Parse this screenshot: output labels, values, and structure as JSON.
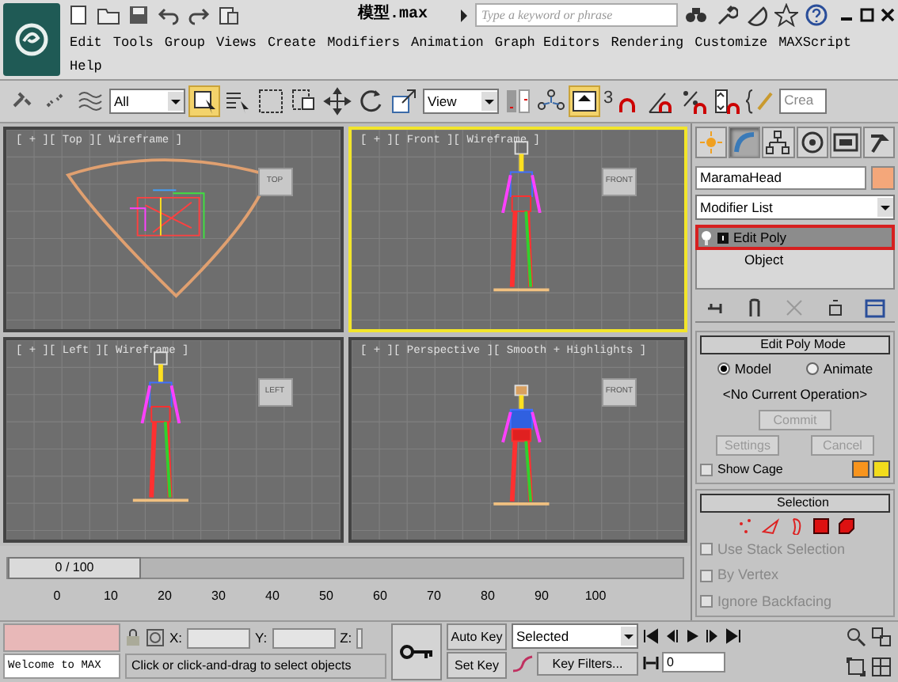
{
  "title_bar": {
    "title": "模型.max",
    "search": {
      "placeholder": "Type a keyword or phrase"
    }
  },
  "menu": [
    {
      "label": "Edit"
    },
    {
      "label": "Tools"
    },
    {
      "label": "Group"
    },
    {
      "label": "Views"
    },
    {
      "label": "Create"
    },
    {
      "label": "Modifiers"
    },
    {
      "label": "Animation"
    },
    {
      "label": "Graph Editors"
    },
    {
      "label": "Rendering"
    },
    {
      "label": "Customize"
    },
    {
      "label": "MAXScript"
    },
    {
      "label": "Help"
    }
  ],
  "toolbar": {
    "selection_filter": "All",
    "reference_coord": "View",
    "angle_snap_label": "3",
    "named_selection": "Crea"
  },
  "viewports": [
    {
      "kind": "top",
      "label": "[ + ][ Top ][ Wireframe ]",
      "cube_label": "TOP",
      "selected": false
    },
    {
      "kind": "front",
      "label": "[ + ][ Front ][ Wireframe ]",
      "cube_label": "FRONT",
      "selected": true
    },
    {
      "kind": "left",
      "label": "[ + ][ Left ][ Wireframe ]",
      "cube_label": "LEFT",
      "selected": false
    },
    {
      "kind": "perspective",
      "label": "[ + ][ Perspective ][ Smooth + Highlights ]",
      "cube_label": "FRONT",
      "selected": false
    }
  ],
  "command_panel": {
    "tabs": [
      {
        "selected": false
      },
      {
        "selected": true
      },
      {
        "selected": false
      },
      {
        "selected": false
      },
      {
        "selected": false
      },
      {
        "selected": false
      }
    ],
    "object": {
      "name": "MaramaHead",
      "color": "#f4a77a"
    },
    "modifier_list": "Modifier List",
    "stack": [
      {
        "label": "Edit Poly",
        "selected": true
      },
      {
        "label": "Object",
        "selected": false
      }
    ],
    "edit_poly_mode": {
      "title": "Edit Poly Mode",
      "modes": [
        {
          "label": "Model",
          "selected": true
        },
        {
          "label": "Animate",
          "selected": false
        }
      ],
      "operation": "<No Current Operation>",
      "commit": {
        "label": "Commit",
        "disabled": true
      },
      "settings": {
        "label": "Settings",
        "disabled": true
      },
      "cancel": {
        "label": "Cancel",
        "disabled": true
      },
      "show_cage": {
        "label": "Show Cage",
        "checked": false
      },
      "cage_colors": [
        {
          "color": "#f7941d"
        },
        {
          "color": "#f2dc1c"
        }
      ]
    },
    "selection": {
      "title": "Selection",
      "options": [
        {
          "label": "Use Stack Selection",
          "checked": false,
          "disabled": true
        },
        {
          "label": "By Vertex",
          "checked": false,
          "disabled": true
        },
        {
          "label": "Ignore Backfacing",
          "checked": false,
          "disabled": true
        }
      ]
    }
  },
  "timeline": {
    "slider_label": "0 / 100",
    "ticks": [
      "0",
      "10",
      "20",
      "30",
      "40",
      "50",
      "60",
      "70",
      "80",
      "90",
      "100"
    ]
  },
  "status": {
    "welcome": "Welcome to MAX",
    "x_label": "X:",
    "y_label": "Y:",
    "z_label": "Z:",
    "prompt": "Click or click-and-drag to select objects",
    "auto_key": "Auto Key",
    "set_key": "Set Key",
    "key_mode": "Selected",
    "key_filters": "Key Filters...",
    "frame": "0"
  }
}
